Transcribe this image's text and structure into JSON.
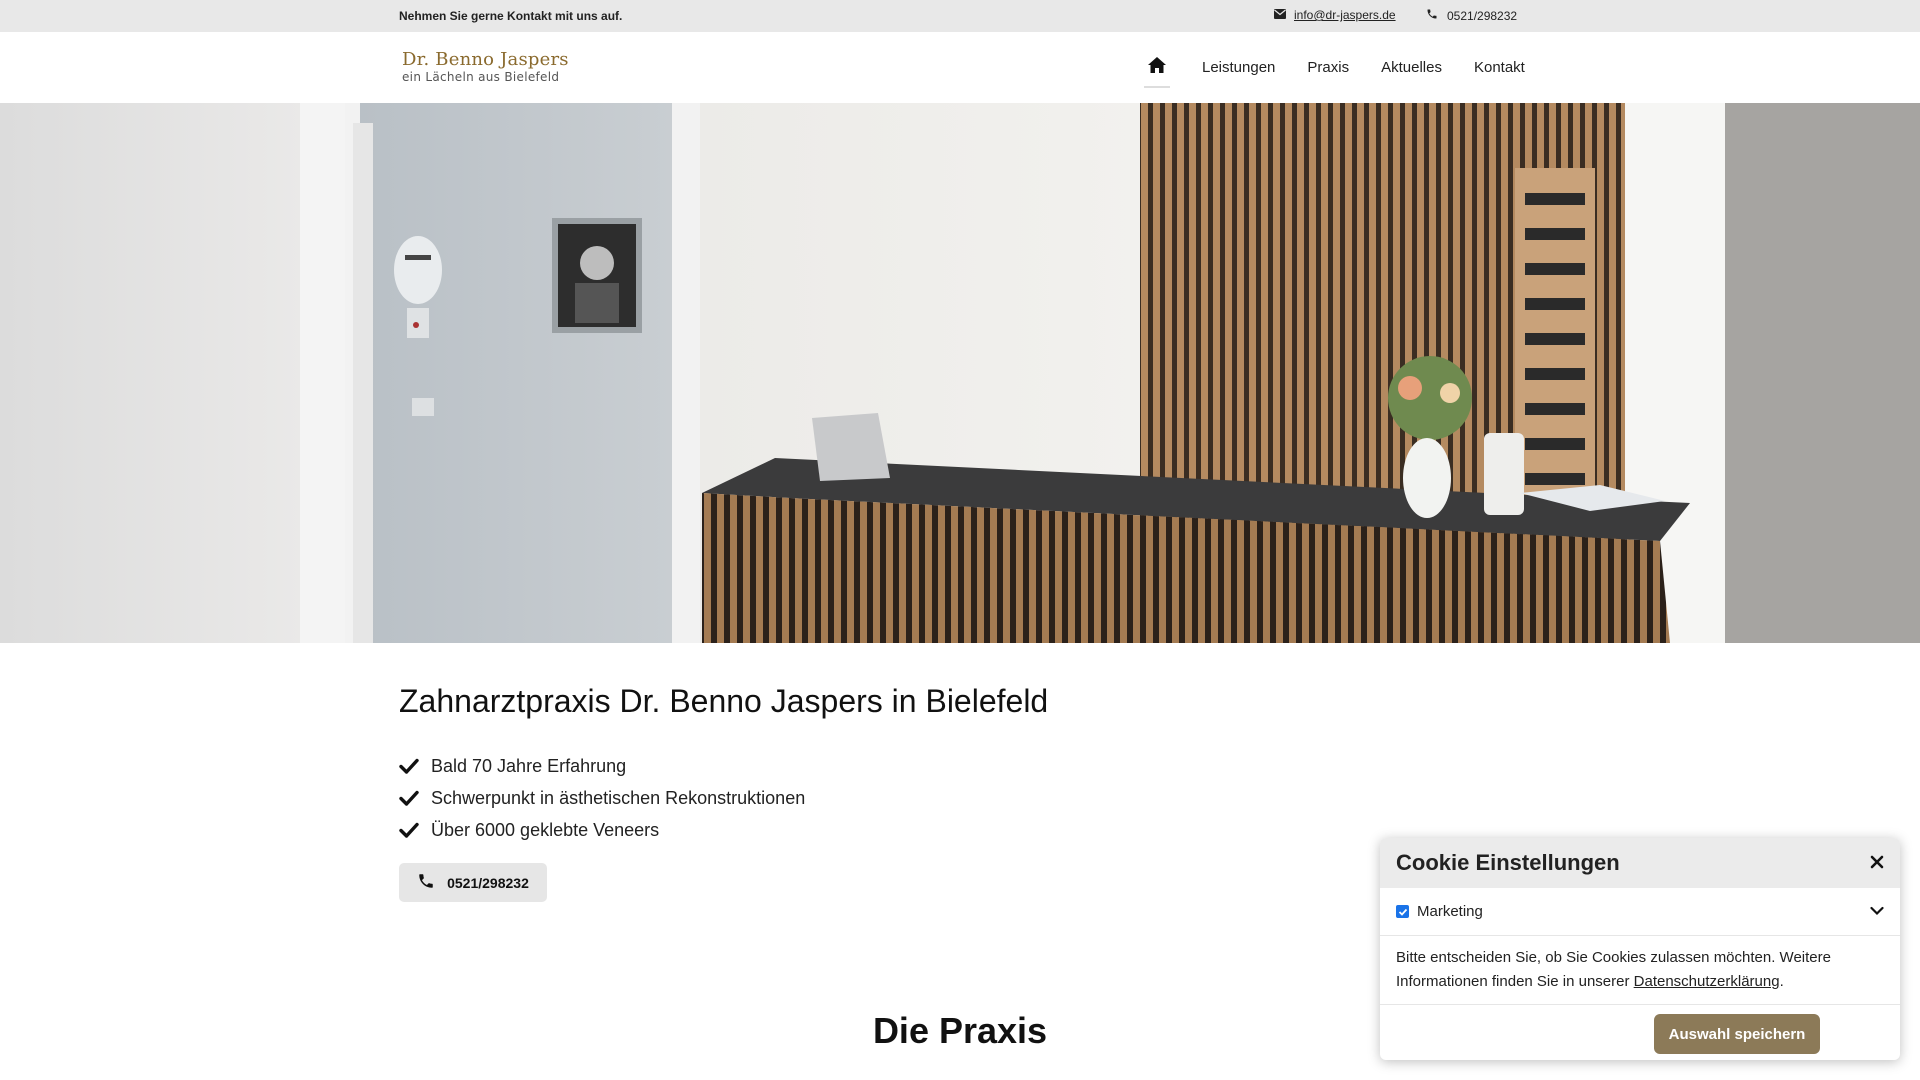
{
  "topbar": {
    "contact_text": "Nehmen Sie gerne Kontakt mit uns auf.",
    "email": "info@dr-jaspers.de",
    "phone": "0521/298232"
  },
  "header": {
    "logo_line1": "Dr. Benno Jaspers",
    "logo_line2": "ein Lächeln aus Bielefeld",
    "nav": {
      "home_icon": "home-icon",
      "items": [
        "Leistungen",
        "Praxis",
        "Aktuelles",
        "Kontakt"
      ]
    }
  },
  "main": {
    "title": "Zahnarztpraxis Dr. Benno Jaspers in Bielefeld",
    "features": [
      "Bald 70 Jahre Erfahrung",
      "Schwerpunkt in ästhetischen Rekonstruktionen",
      "Über 6000 geklebte Veneers"
    ],
    "call_button": "0521/298232",
    "section_title": "Die Praxis"
  },
  "cookie": {
    "title": "Cookie Einstellungen",
    "close_icon": "close-icon",
    "option_label": "Marketing",
    "option_checked": true,
    "text_before": "Bitte entscheiden Sie, ob Sie Cookies zulassen möchten. Weitere Informationen finden Sie in unserer ",
    "link_text": "Datenschutzerklärung",
    "text_after": ".",
    "save_button": "Auswahl speichern"
  },
  "colors": {
    "topbar_bg": "#e8e8e8",
    "logo_gold": "#8a6a2e",
    "accent_button": "#8c7a58",
    "checkbox_blue": "#1a73e8"
  }
}
